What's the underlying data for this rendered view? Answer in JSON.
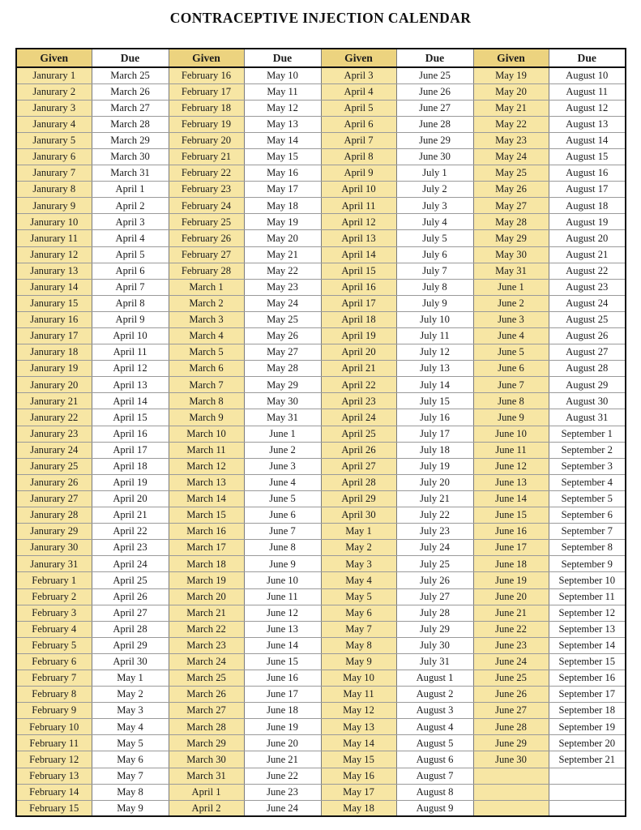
{
  "document": {
    "title": "CONTRACEPTIVE INJECTION CALENDAR"
  },
  "table": {
    "headers": [
      "Given",
      "Due",
      "Given",
      "Due",
      "Given",
      "Due",
      "Given",
      "Due"
    ],
    "column_groups": 4,
    "row_count": 46,
    "colors": {
      "given_header_bg": "#ecd37f",
      "given_cell_bg": "#f7e6a4",
      "due_cell_bg": "#ffffff",
      "border": "#111111",
      "text": "#1a1a1a"
    },
    "rows": [
      [
        "Janurary 1",
        "March 25",
        "February 16",
        "May 10",
        "April 3",
        "June 25",
        "May 19",
        "August 10"
      ],
      [
        "Janurary 2",
        "March 26",
        "February 17",
        "May 11",
        "April 4",
        "June 26",
        "May 20",
        "August 11"
      ],
      [
        "Janurary 3",
        "March 27",
        "February 18",
        "May 12",
        "April 5",
        "June 27",
        "May 21",
        "August 12"
      ],
      [
        "Janurary 4",
        "March 28",
        "February 19",
        "May 13",
        "April 6",
        "June 28",
        "May 22",
        "August 13"
      ],
      [
        "Janurary 5",
        "March 29",
        "February 20",
        "May 14",
        "April 7",
        "June 29",
        "May 23",
        "August 14"
      ],
      [
        "Janurary 6",
        "March 30",
        "February 21",
        "May 15",
        "April 8",
        "June 30",
        "May 24",
        "August 15"
      ],
      [
        "Janurary 7",
        "March 31",
        "February 22",
        "May 16",
        "April 9",
        "July 1",
        "May 25",
        "August 16"
      ],
      [
        "Janurary 8",
        "April 1",
        "February 23",
        "May 17",
        "April 10",
        "July 2",
        "May 26",
        "August 17"
      ],
      [
        "Janurary 9",
        "April 2",
        "February 24",
        "May 18",
        "April 11",
        "July 3",
        "May 27",
        "August 18"
      ],
      [
        "Janurary 10",
        "April 3",
        "February 25",
        "May 19",
        "April 12",
        "July 4",
        "May 28",
        "August 19"
      ],
      [
        "Janurary 11",
        "April 4",
        "February 26",
        "May 20",
        "April 13",
        "July 5",
        "May 29",
        "August 20"
      ],
      [
        "Janurary 12",
        "April 5",
        "February 27",
        "May 21",
        "April 14",
        "July 6",
        "May 30",
        "August 21"
      ],
      [
        "Janurary 13",
        "April 6",
        "February 28",
        "May 22",
        "April 15",
        "July 7",
        "May 31",
        "August 22"
      ],
      [
        "Janurary 14",
        "April 7",
        "March 1",
        "May 23",
        "April 16",
        "July 8",
        "June 1",
        "August 23"
      ],
      [
        "Janurary 15",
        "April 8",
        "March 2",
        "May 24",
        "April 17",
        "July 9",
        "June 2",
        "August 24"
      ],
      [
        "Janurary 16",
        "April 9",
        "March 3",
        "May 25",
        "April 18",
        "July 10",
        "June 3",
        "August 25"
      ],
      [
        "Janurary 17",
        "April 10",
        "March 4",
        "May 26",
        "April 19",
        "July 11",
        "June 4",
        "August 26"
      ],
      [
        "Janurary 18",
        "April 11",
        "March 5",
        "May 27",
        "April 20",
        "July 12",
        "June 5",
        "August 27"
      ],
      [
        "Janurary 19",
        "April 12",
        "March 6",
        "May 28",
        "April 21",
        "July 13",
        "June 6",
        "August 28"
      ],
      [
        "Janurary 20",
        "April 13",
        "March 7",
        "May 29",
        "April 22",
        "July 14",
        "June 7",
        "August 29"
      ],
      [
        "Janurary 21",
        "April 14",
        "March 8",
        "May 30",
        "April 23",
        "July 15",
        "June 8",
        "August 30"
      ],
      [
        "Janurary 22",
        "April 15",
        "March 9",
        "May 31",
        "April 24",
        "July 16",
        "June 9",
        "August 31"
      ],
      [
        "Janurary 23",
        "April 16",
        "March 10",
        "June 1",
        "April 25",
        "July 17",
        "June 10",
        "September 1"
      ],
      [
        "Janurary 24",
        "April 17",
        "March 11",
        "June 2",
        "April 26",
        "July 18",
        "June 11",
        "September 2"
      ],
      [
        "Janurary 25",
        "April 18",
        "March 12",
        "June 3",
        "April 27",
        "July 19",
        "June 12",
        "September 3"
      ],
      [
        "Janurary 26",
        "April 19",
        "March 13",
        "June 4",
        "April 28",
        "July 20",
        "June 13",
        "September 4"
      ],
      [
        "Janurary 27",
        "April 20",
        "March 14",
        "June 5",
        "April 29",
        "July 21",
        "June 14",
        "September 5"
      ],
      [
        "Janurary 28",
        "April 21",
        "March 15",
        "June 6",
        "April 30",
        "July 22",
        "June 15",
        "September 6"
      ],
      [
        "Janurary 29",
        "April 22",
        "March 16",
        "June 7",
        "May 1",
        "July 23",
        "June 16",
        "September 7"
      ],
      [
        "Janurary 30",
        "April 23",
        "March 17",
        "June 8",
        "May 2",
        "July 24",
        "June 17",
        "September 8"
      ],
      [
        "Janurary 31",
        "April 24",
        "March 18",
        "June 9",
        "May 3",
        "July 25",
        "June 18",
        "September 9"
      ],
      [
        "February 1",
        "April 25",
        "March 19",
        "June 10",
        "May 4",
        "July 26",
        "June 19",
        "September 10"
      ],
      [
        "February 2",
        "April 26",
        "March 20",
        "June 11",
        "May 5",
        "July 27",
        "June 20",
        "September 11"
      ],
      [
        "February 3",
        "April 27",
        "March 21",
        "June 12",
        "May 6",
        "July 28",
        "June 21",
        "September 12"
      ],
      [
        "February 4",
        "April 28",
        "March 22",
        "June 13",
        "May 7",
        "July 29",
        "June 22",
        "September 13"
      ],
      [
        "February 5",
        "April 29",
        "March 23",
        "June 14",
        "May 8",
        "July 30",
        "June 23",
        "September 14"
      ],
      [
        "February 6",
        "April 30",
        "March 24",
        "June 15",
        "May 9",
        "July 31",
        "June 24",
        "September 15"
      ],
      [
        "February 7",
        "May 1",
        "March 25",
        "June 16",
        "May 10",
        "August 1",
        "June 25",
        "September 16"
      ],
      [
        "February 8",
        "May 2",
        "March 26",
        "June 17",
        "May 11",
        "August 2",
        "June 26",
        "September 17"
      ],
      [
        "February 9",
        "May 3",
        "March 27",
        "June 18",
        "May 12",
        "August 3",
        "June 27",
        "September 18"
      ],
      [
        "February 10",
        "May 4",
        "March 28",
        "June 19",
        "May 13",
        "August 4",
        "June 28",
        "September 19"
      ],
      [
        "February 11",
        "May 5",
        "March 29",
        "June 20",
        "May 14",
        "August 5",
        "June 29",
        "September 20"
      ],
      [
        "February 12",
        "May 6",
        "March 30",
        "June 21",
        "May 15",
        "August 6",
        "June 30",
        "September 21"
      ],
      [
        "February 13",
        "May 7",
        "March 31",
        "June 22",
        "May 16",
        "August 7",
        "",
        ""
      ],
      [
        "February 14",
        "May 8",
        "April 1",
        "June 23",
        "May 17",
        "August 8",
        "",
        ""
      ],
      [
        "February 15",
        "May 9",
        "April 2",
        "June 24",
        "May 18",
        "August 9",
        "",
        ""
      ]
    ]
  }
}
